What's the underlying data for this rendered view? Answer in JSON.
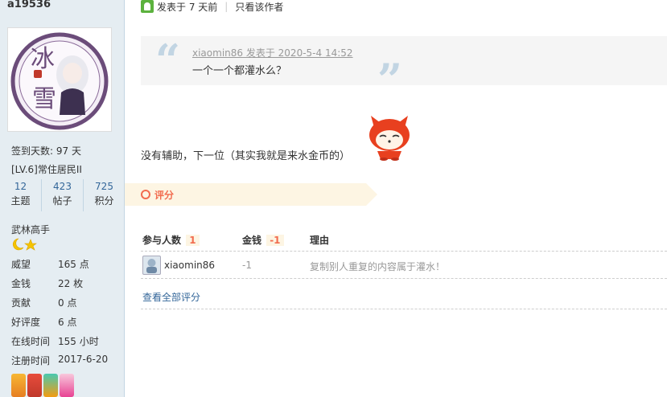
{
  "sidebar": {
    "username": "a19536",
    "checkin": "签到天数: 97 天",
    "level": "[LV.6]常住居民II",
    "counts": [
      {
        "num": "12",
        "label": "主题"
      },
      {
        "num": "423",
        "label": "帖子"
      },
      {
        "num": "725",
        "label": "积分"
      }
    ],
    "title": "武林高手",
    "props": [
      {
        "key": "威望",
        "val": "165 点"
      },
      {
        "key": "金钱",
        "val": "22 枚"
      },
      {
        "key": "贡献",
        "val": "0 点"
      },
      {
        "key": "好评度",
        "val": "6 点"
      },
      {
        "key": "在线时间",
        "val": "155 小时"
      },
      {
        "key": "注册时间",
        "val": "2017-6-20"
      }
    ],
    "avatar_text": [
      "冰",
      "雪"
    ]
  },
  "post": {
    "posted": "发表于 7 天前",
    "author_only": "只看该作者",
    "quote": {
      "meta": "xiaomin86 发表于 2020-5-4 14:52",
      "text": "一个一个都灌水么？"
    },
    "body": "没有辅助，下一位（其实我就是来水金币的）"
  },
  "rating": {
    "label": "评分",
    "headers": {
      "participants": "参与人数",
      "participants_count": "1",
      "money": "金钱",
      "money_total": "-1",
      "reason": "理由"
    },
    "rows": [
      {
        "user": "xiaomin86",
        "money": "-1",
        "reason": "复制别人重复的内容属于灌水！"
      }
    ],
    "view_all": "查看全部评分"
  },
  "colors": {
    "accent": "#f26c4f",
    "link": "#336699",
    "sidebar_bg": "#e5edf2"
  },
  "icons": [
    "online-icon",
    "quote-icon",
    "emoticon-fox-icon",
    "rate-icon",
    "star-icon",
    "moon-icon",
    "medal-icon"
  ]
}
